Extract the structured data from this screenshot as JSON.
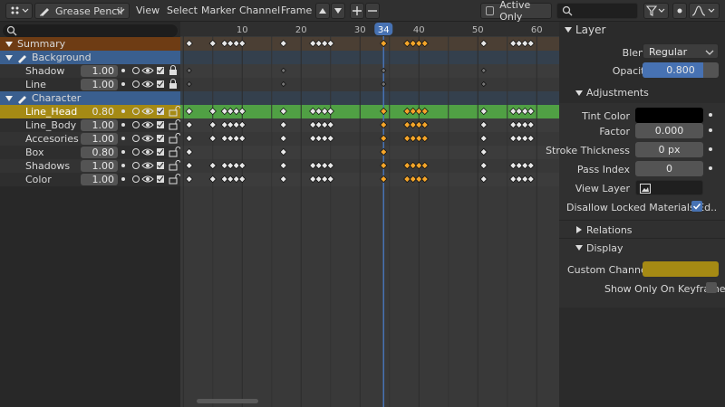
{
  "header": {
    "editor_type_icon": "dopesheet-icon",
    "mode_label": "Grease Pencil",
    "menus": [
      "View",
      "Select",
      "Marker",
      "Channel",
      "Frame"
    ],
    "active_only_label": "Active Only",
    "search_placeholder": ""
  },
  "ruler": {
    "ticks": [
      "10",
      "20",
      "30",
      "40",
      "50",
      "60"
    ],
    "current_frame": "34"
  },
  "channels": {
    "summary_label": "Summary",
    "groups": [
      {
        "name": "Background",
        "layers": [
          {
            "name": "Shadow",
            "value": "1.00"
          },
          {
            "name": "Line",
            "value": "1.00"
          }
        ]
      },
      {
        "name": "Character",
        "layers": [
          {
            "name": "Line_Head",
            "value": "0.80",
            "active": true
          },
          {
            "name": "Line_Body",
            "value": "1.00"
          },
          {
            "name": "Accesories",
            "value": "1.00"
          },
          {
            "name": "Box",
            "value": "0.80"
          },
          {
            "name": "Shadows",
            "value": "1.00"
          },
          {
            "name": "Color",
            "value": "1.00"
          }
        ]
      }
    ]
  },
  "panel": {
    "title": "Layer",
    "blend_label": "Blend",
    "blend_value": "Regular",
    "opacity_label": "Opacity",
    "opacity_value": "0.800",
    "opacity_fraction": 0.8,
    "adjustments_label": "Adjustments",
    "tint_color_label": "Tint Color",
    "tint_color": "#000000",
    "factor_label": "Factor",
    "factor_value": "0.000",
    "stroke_thickness_label": "Stroke Thickness",
    "stroke_thickness_value": "0 px",
    "pass_index_label": "Pass Index",
    "pass_index_value": "0",
    "view_layer_label": "View Layer",
    "disallow_label": "Disallow Locked Materials Ed..",
    "disallow_checked": true,
    "relations_label": "Relations",
    "display_label": "Display",
    "custom_channel_label": "Custom Channel ..",
    "custom_channel_color": "#a58a14",
    "show_only_keyframed_label": "Show Only On Keyframed",
    "show_only_keyframed_checked": false
  },
  "colors": {
    "accent": "#4772b3",
    "active_row": "#50a044",
    "group_row": "#3a5f8f",
    "summary_row": "#6e3c14",
    "active_layer": "#a58a14",
    "keyframe_selected": "#f4a52a"
  }
}
